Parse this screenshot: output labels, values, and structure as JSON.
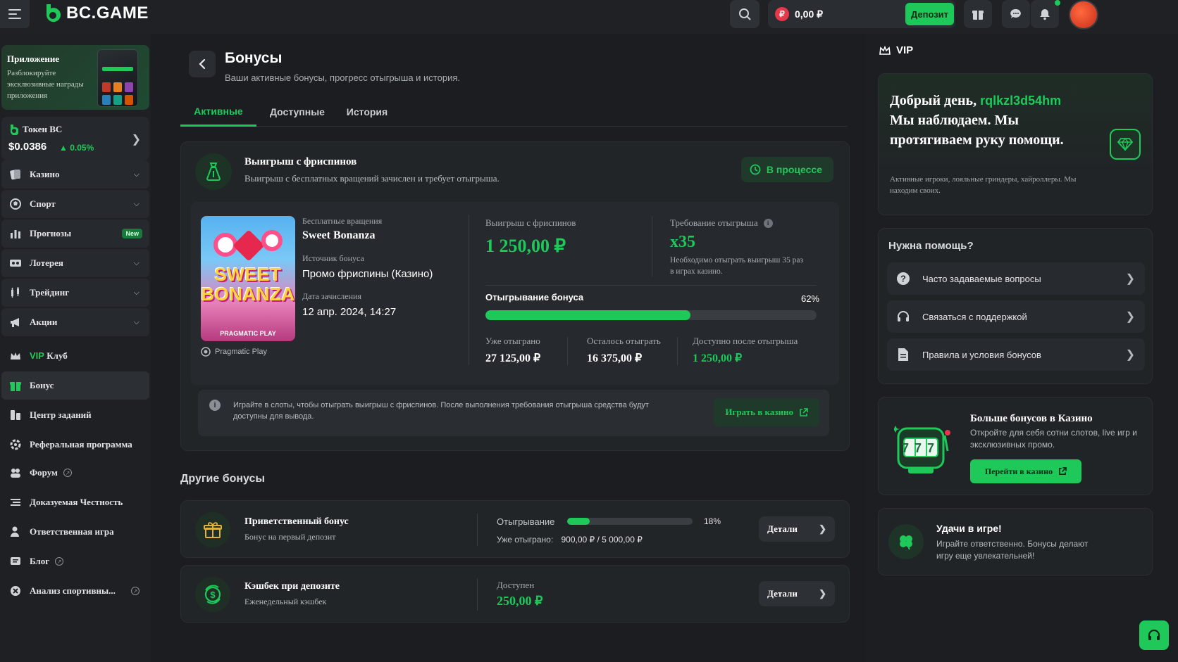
{
  "header": {
    "logo_text": "BC.GAME",
    "balance": "0,00 ₽",
    "currency_symbol": "₽",
    "deposit_label": "Депозит"
  },
  "sidebar": {
    "app_promo": {
      "title": "Приложение",
      "subtitle": "Разблокируйте эксклюзивные награды приложения"
    },
    "token": {
      "title": "Токен BC",
      "price": "$0.0386",
      "change": "0.05%"
    },
    "items": [
      {
        "label": "Казино",
        "icon": "cards-icon"
      },
      {
        "label": "Спорт",
        "icon": "ball-icon"
      },
      {
        "label": "Прогнозы",
        "icon": "chart-icon",
        "badge": "New"
      },
      {
        "label": "Лотерея",
        "icon": "ticket-icon"
      },
      {
        "label": "Трейдинг",
        "icon": "trading-icon"
      },
      {
        "label": "Акции",
        "icon": "megaphone-icon"
      },
      {
        "label_accent": "VIP",
        "label": "Клуб",
        "icon": "crown-icon"
      },
      {
        "label": "Бонус",
        "icon": "gift-icon"
      },
      {
        "label": "Центр заданий",
        "icon": "tasks-icon"
      },
      {
        "label": "Реферальная программа",
        "icon": "referral-icon"
      },
      {
        "label": "Форум",
        "icon": "forum-icon"
      },
      {
        "label": "Доказуемая Честность",
        "icon": "fairness-icon"
      },
      {
        "label": "Ответственная игра",
        "icon": "responsible-icon"
      },
      {
        "label": "Блог",
        "icon": "blog-icon"
      },
      {
        "label": "Анализ спортивны...",
        "icon": "analysis-icon"
      }
    ]
  },
  "main": {
    "title": "Бонусы",
    "subtitle": "Ваши активные бонусы, прогресс отыгрыша и история.",
    "tabs": [
      "Активные",
      "Доступные",
      "История"
    ],
    "active_bonus": {
      "title": "Выигрыш с фриспинов",
      "subtitle": "Выигрыш с бесплатных вращений зачислен и требует отыгрыша.",
      "status": "В процессе",
      "game_type_label": "Бесплатные вращения",
      "game_name": "Sweet Bonanza",
      "source_label": "Источник бонуса",
      "source_value": "Промо фриспины (Казино)",
      "date_label": "Дата зачисления",
      "date_value": "12 апр. 2024, 14:27",
      "provider": "Pragmatic Play",
      "thumb_title_1": "SWEET",
      "thumb_title_2": "BONANZA",
      "thumb_brand": "PRAGMATIC PLAY",
      "winnings_label": "Выигрыш с фриспинов",
      "winnings_value": "1 250,00 ₽",
      "wager_label": "Требование отыгрыша",
      "wager_value": "x35",
      "wager_note": "Необходимо отыграть выигрыш 35 раз в играх казино.",
      "progress_label": "Отыгрывание бонуса",
      "progress_percent_text": "62%",
      "progress_fraction": 0.62,
      "wagered_label": "Уже отыграно",
      "wagered_value": "27 125,00 ₽",
      "remaining_label": "Осталось отыграть",
      "remaining_value": "16 375,00 ₽",
      "available_label": "Доступно после отыгрыша",
      "available_value": "1 250,00 ₽",
      "info_text": "Играйте в слоты, чтобы отыграть выигрыш с фриспинов. После выполнения требования отыгрыша средства будут доступны для вывода.",
      "play_button": "Играть в казино"
    },
    "other_title": "Другие бонусы",
    "other_bonuses": [
      {
        "title": "Приветственный бонус",
        "subtitle": "Бонус на первый депозит",
        "progress_label": "Отыгрывание",
        "progress_percent_text": "18%",
        "progress_fraction": 0.18,
        "wagered_label": "Уже отыграно:",
        "wagered_value": "900,00 ₽  /  5 000,00 ₽",
        "button": "Детали"
      },
      {
        "title": "Кэшбек при депозите",
        "subtitle": "Еженедельный кэшбек",
        "available_label": "Доступен",
        "available_value": "250,00 ₽",
        "button": "Детали"
      }
    ]
  },
  "right": {
    "vip_label": "VIP",
    "greeting_prefix": "Добрый день,",
    "username": "rqlkzl3d54hm",
    "greeting_body": "Мы наблюдаем. Мы протягиваем руку помощи.",
    "vip_note": "Активные игроки, лояльные гриндеры, хайроллеры. Мы находим своих.",
    "help_title": "Нужна помощь?",
    "help_items": [
      "Часто задаваемые вопросы",
      "Связаться с поддержкой",
      "Правила и условия бонусов"
    ],
    "casino_title": "Больше бонусов в Казино",
    "casino_sub": "Откройте для себя сотни слотов, live игр и эксклюзивных промо.",
    "casino_button": "Перейти в казино",
    "luck_title": "Удачи в игре!",
    "luck_sub": "Играйте ответственно. Бонусы делают игру еще увлекательней!",
    "slot_digits": "777"
  },
  "colors": {
    "accent": "#1ec95a",
    "background": "#1b1d20",
    "card": "#222528"
  }
}
